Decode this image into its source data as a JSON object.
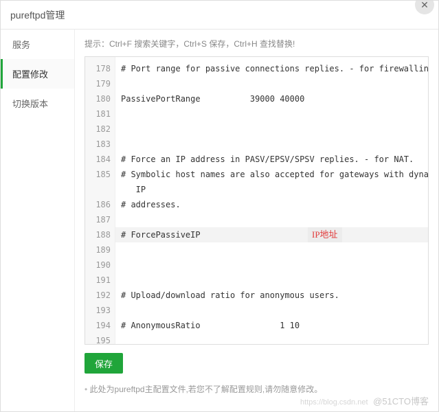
{
  "window": {
    "title": "pureftpd管理",
    "close_icon": "✕"
  },
  "sidebar": {
    "items": [
      {
        "label": "服务"
      },
      {
        "label": "配置修改"
      },
      {
        "label": "切换版本"
      }
    ]
  },
  "hint": "提示：Ctrl+F 搜索关键字，Ctrl+S 保存，Ctrl+H 查找替换!",
  "editor": {
    "lines": [
      {
        "n": 178,
        "text": "# Port range for passive connections replies. - for firewalling."
      },
      {
        "n": 179,
        "text": ""
      },
      {
        "n": 180,
        "text": "PassivePortRange          39000 40000"
      },
      {
        "n": 181,
        "text": ""
      },
      {
        "n": 182,
        "text": ""
      },
      {
        "n": 183,
        "text": ""
      },
      {
        "n": 184,
        "text": "# Force an IP address in PASV/EPSV/SPSV replies. - for NAT."
      },
      {
        "n": 185,
        "text": "# Symbolic host names are also accepted for gateways with dynamic\n   IP"
      },
      {
        "n": 186,
        "text": "# addresses."
      },
      {
        "n": 187,
        "text": ""
      },
      {
        "n": 188,
        "text": "# ForcePassiveIP",
        "hl": true,
        "annot": "IP地址"
      },
      {
        "n": 189,
        "text": ""
      },
      {
        "n": 190,
        "text": ""
      },
      {
        "n": 191,
        "text": ""
      },
      {
        "n": 192,
        "text": "# Upload/download ratio for anonymous users."
      },
      {
        "n": 193,
        "text": ""
      },
      {
        "n": 194,
        "text": "# AnonymousRatio                1 10"
      },
      {
        "n": 195,
        "text": ""
      }
    ]
  },
  "save_label": "保存",
  "footnote": "此处为pureftpd主配置文件,若您不了解配置规则,请勿随意修改。",
  "watermark": {
    "sub": "https://blog.csdn.net",
    "main": "@51CTO博客"
  }
}
